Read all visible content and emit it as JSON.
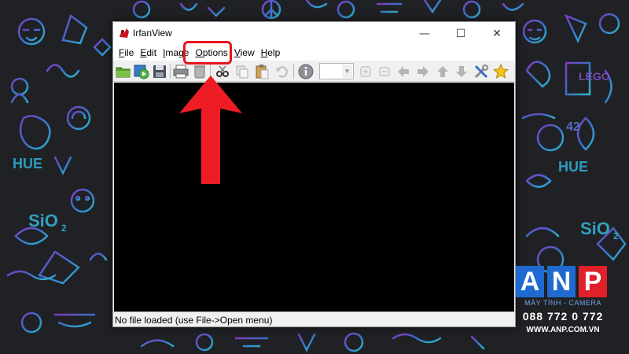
{
  "window": {
    "title": "IrfanView",
    "min_glyph": "—",
    "max_glyph": "☐",
    "close_glyph": "✕"
  },
  "menu": [
    {
      "label": "File",
      "ul": "F",
      "rest": "ile"
    },
    {
      "label": "Edit",
      "ul": "E",
      "rest": "dit"
    },
    {
      "label": "Image",
      "ul": "I",
      "rest": "mage"
    },
    {
      "label": "Options",
      "ul": "O",
      "rest": "ptions"
    },
    {
      "label": "View",
      "ul": "V",
      "rest": "iew"
    },
    {
      "label": "Help",
      "ul": "H",
      "rest": "elp"
    }
  ],
  "toolbar": {
    "icons": [
      "open-folder-icon",
      "slideshow-icon",
      "save-icon",
      "print-icon",
      "delete-icon",
      "cut-icon",
      "copy-icon",
      "paste-icon",
      "undo-icon",
      "info-icon",
      "zoom-combo",
      "rotate-left-icon",
      "rotate-right-icon",
      "prev-icon",
      "next-icon",
      "up-icon",
      "down-icon",
      "settings-icon",
      "favorites-icon"
    ],
    "zoom_value": ""
  },
  "status": {
    "text": "No file loaded (use File->Open menu)"
  },
  "watermark": {
    "letters": [
      "A",
      "N",
      "P"
    ],
    "subtitle": "MÁY TÍNH - CAMERA",
    "phone": "088 772 0 772",
    "website": "WWW.ANP.COM.VN"
  },
  "colors": {
    "annotation": "#e8141c",
    "anp_blue": "#1e6ad1",
    "anp_red": "#e0202a"
  }
}
